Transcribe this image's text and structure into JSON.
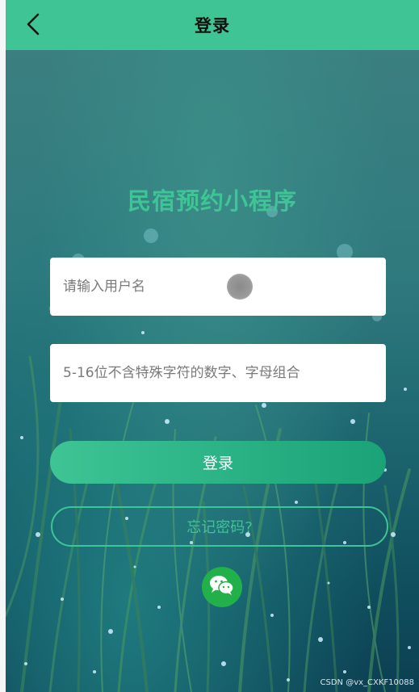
{
  "header": {
    "title": "登录",
    "back_icon": "chevron-left-icon",
    "background_color": "#3ec495"
  },
  "app_title": "民宿预约小程序",
  "form": {
    "username_placeholder": "请输入用户名",
    "password_placeholder": "5-16位不含特殊字符的数字、字母组合",
    "login_label": "登录",
    "forgot_label": "忘记密码?",
    "wechat_icon": "wechat-icon"
  },
  "colors": {
    "accent": "#3ec495",
    "wechat": "#22b04a"
  },
  "watermark": "CSDN @vx_CXKF10088"
}
